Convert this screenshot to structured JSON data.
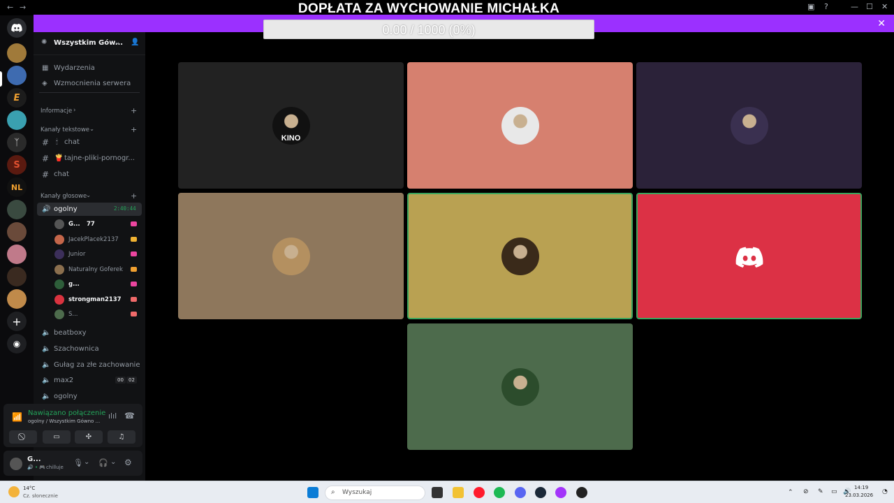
{
  "overlay": {
    "title": "DOPŁATA ZA WYCHOWANIE MICHAŁKA",
    "progress_text": "0.00 / 1000 (0%)",
    "progress_fraction": 0,
    "accent": "#9b30ff"
  },
  "server": {
    "name": "Wszystkim Gów...",
    "top_items": [
      {
        "label": "Wydarzenia",
        "icon": "calendar-icon"
      },
      {
        "label": "Wzmocnienia serwera",
        "icon": "boost-icon"
      }
    ],
    "categories": {
      "info": "Informacje",
      "text": "Kanały tekstowe",
      "voice": "Kanały głosowe"
    },
    "text_channels": [
      "chat",
      "tajne-pliki-pornogr...",
      "chat"
    ],
    "text_channel_emojis": [
      "🕯",
      "🍟",
      ""
    ],
    "active_voice": {
      "name": "ogolny",
      "timer": "2:40:44"
    },
    "voice_members": [
      {
        "name": "G...",
        "extra": "77",
        "color": "#555"
      },
      {
        "name": "JacekPlacek2137",
        "extra": "",
        "color": "#c4664a"
      },
      {
        "name": "Junior",
        "extra": "",
        "color": "#3c2f5a"
      },
      {
        "name": "Naturalny Goferek",
        "extra": "",
        "color": "#8b6f4e"
      },
      {
        "name": "g...",
        "extra": "",
        "color": "#2e5e3a"
      },
      {
        "name": "strongman2137",
        "extra": "",
        "color": "#d9333f"
      },
      {
        "name": "S...",
        "extra": "",
        "color": "#4d6b4c"
      }
    ],
    "other_voice": [
      "beatboxy",
      "Szachownica",
      "Gułag za złe zachowanie",
      "max2",
      "ogolny"
    ],
    "max2_counts": [
      "00",
      "02"
    ]
  },
  "voice_panel": {
    "status": "Nawiązano połączenie",
    "subtitle": "ogolny / Wszystkim Gówno ..."
  },
  "user": {
    "name": "G...",
    "status": "chilluje"
  },
  "tiles": [
    {
      "bg": "#222222",
      "label": "KINO",
      "avatar": "#111"
    },
    {
      "bg": "#d6806f",
      "label": "",
      "avatar": "#e8e8e8"
    },
    {
      "bg": "#2b2239",
      "label": "",
      "avatar": "#3a3050"
    },
    {
      "bg": "#8e775c",
      "label": "",
      "avatar": "#b49060"
    },
    {
      "bg": "#b9a152",
      "label": "",
      "avatar": "#3a2a1a"
    },
    {
      "bg": "#dc3145",
      "label": "",
      "avatar": "discord"
    },
    {
      "bg": "#4d6b4c",
      "label": "",
      "avatar": "#2c4c2c"
    }
  ],
  "taskbar": {
    "weather_temp": "14°C",
    "weather_desc": "Cz. słonecznie",
    "search_placeholder": "Wyszukaj",
    "time": "14:19",
    "date": "23.03.2026"
  }
}
